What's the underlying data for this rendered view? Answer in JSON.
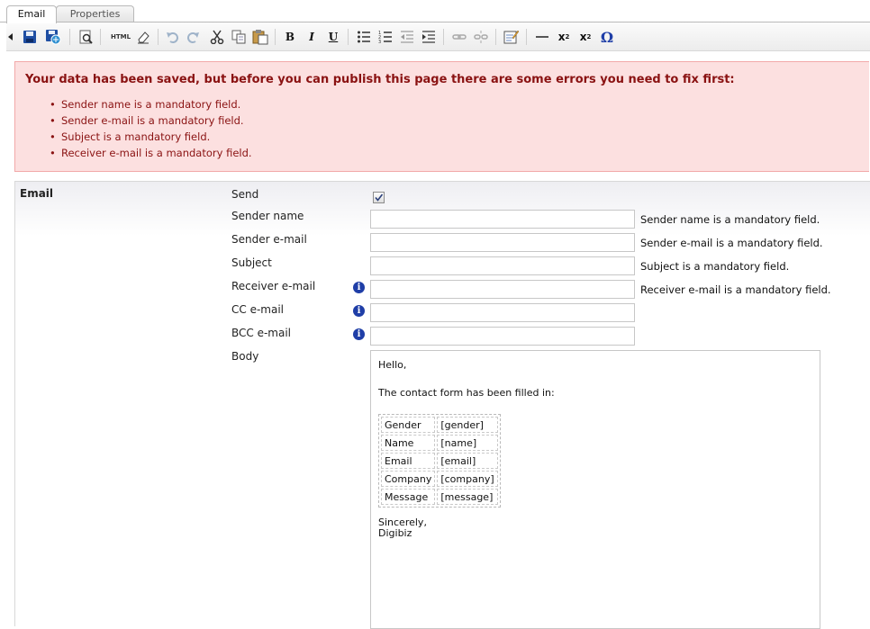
{
  "tabs": [
    {
      "label": "Email",
      "active": true
    },
    {
      "label": "Properties",
      "active": false
    }
  ],
  "toolbar": {
    "buttons": [
      "collapse-arrow",
      "save-icon",
      "save-publish-icon",
      "preview-icon",
      "html-source-icon",
      "eraser-icon",
      "undo-icon",
      "redo-icon",
      "cut-icon",
      "copy-icon",
      "paste-icon",
      "bold-icon",
      "italic-icon",
      "underline-icon",
      "bullet-list-icon",
      "numbered-list-icon",
      "outdent-icon",
      "indent-icon",
      "link-icon",
      "unlink-icon",
      "edit-form-icon",
      "horizontal-rule-icon",
      "subscript-icon",
      "superscript-icon",
      "omega-symbol-icon"
    ],
    "html_label": "HTML",
    "bold_label": "B",
    "italic_label": "I",
    "underline_label": "U",
    "sub_label": "x",
    "sub_index": "2",
    "sup_label": "x",
    "sup_index": "2",
    "omega_label": "Ω"
  },
  "errors": {
    "title": "Your data has been saved, but before you can publish this page there are some errors you need to fix first:",
    "items": [
      "Sender name is a mandatory field.",
      "Sender e-mail is a mandatory field.",
      "Subject is a mandatory field.",
      "Receiver e-mail is a mandatory field."
    ]
  },
  "section": {
    "title": "Email",
    "fields": {
      "send": {
        "label": "Send",
        "checked": true
      },
      "sender_name": {
        "label": "Sender name",
        "value": "",
        "error": "Sender name is a mandatory field."
      },
      "sender_email": {
        "label": "Sender e-mail",
        "value": "",
        "error": "Sender e-mail is a mandatory field."
      },
      "subject": {
        "label": "Subject",
        "value": "",
        "error": "Subject is a mandatory field."
      },
      "receiver_email": {
        "label": "Receiver e-mail",
        "value": "",
        "error": "Receiver e-mail is a mandatory field."
      },
      "cc_email": {
        "label": "CC e-mail",
        "value": ""
      },
      "bcc_email": {
        "label": "BCC e-mail",
        "value": ""
      },
      "body": {
        "label": "Body"
      }
    },
    "info_glyph": "i"
  },
  "body_content": {
    "greeting": "Hello,",
    "intro": "The contact form has been filled in:",
    "table": [
      [
        "Gender",
        "[gender]"
      ],
      [
        "Name",
        "[name]"
      ],
      [
        "Email",
        "[email]"
      ],
      [
        "Company",
        "[company]"
      ],
      [
        "Message",
        "[message]"
      ]
    ],
    "closing": "Sincerely,",
    "signature": "Digibiz"
  }
}
